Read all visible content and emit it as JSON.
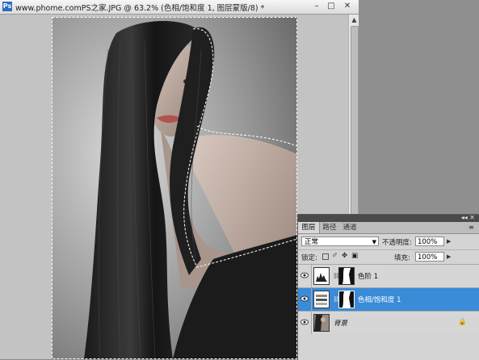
{
  "document": {
    "title": "www.phome.comPS之家.JPG @ 63.2% (色相/饱和度 1, 图层蒙版/8) *",
    "app_icon": "Ps",
    "controls": {
      "minimize": "–",
      "maximize": "□",
      "close": "✕"
    }
  },
  "layers_panel": {
    "tabs": [
      "图层",
      "路径",
      "通道"
    ],
    "blend_mode": "正常",
    "opacity_label": "不透明度:",
    "opacity_value": "100%",
    "lock_label": "锁定:",
    "fill_label": "填充:",
    "fill_value": "100%",
    "layers": [
      {
        "name": "色阶 1",
        "selected": false,
        "type": "adjustment-levels"
      },
      {
        "name": "色相/饱和度 1",
        "selected": true,
        "type": "adjustment-hue-saturation"
      },
      {
        "name": "背景",
        "selected": false,
        "type": "background",
        "locked": true
      }
    ]
  },
  "colors": {
    "selection_blue": "#3a8bd8",
    "panel_bg": "#d4d4d4",
    "workspace": "#8a8a8a"
  }
}
